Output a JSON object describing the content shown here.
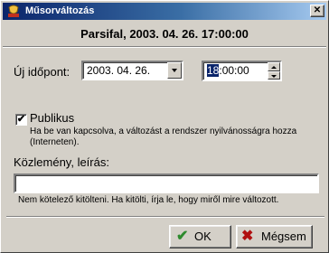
{
  "window": {
    "title": "Műsorváltozás"
  },
  "header": {
    "text": "Parsifal, 2003. 04. 26. 17:00:00"
  },
  "new_time": {
    "label": "Új időpont:",
    "date_value": "2003. 04. 26.",
    "time_selected": "18",
    "time_rest": ":00:00"
  },
  "public": {
    "label": "Publikus",
    "checked": true,
    "check_mark": "✔",
    "hint": "Ha be van kapcsolva, a változást a rendszer nyilvánosságra hozza (Interneten)."
  },
  "note": {
    "label": "Közlemény, leírás:",
    "value": "",
    "hint": "Nem kötelező kitölteni. Ha kitölti, írja le, hogy miről mire változott."
  },
  "buttons": {
    "ok_label": "OK",
    "cancel_label": "Mégsem"
  },
  "icons": {
    "title": "app-icon",
    "ok": "check-icon",
    "cancel": "x-icon"
  },
  "colors": {
    "titlebar": "#0a246a",
    "ok_check": "#2e8b2e",
    "cancel_x": "#b01010"
  }
}
